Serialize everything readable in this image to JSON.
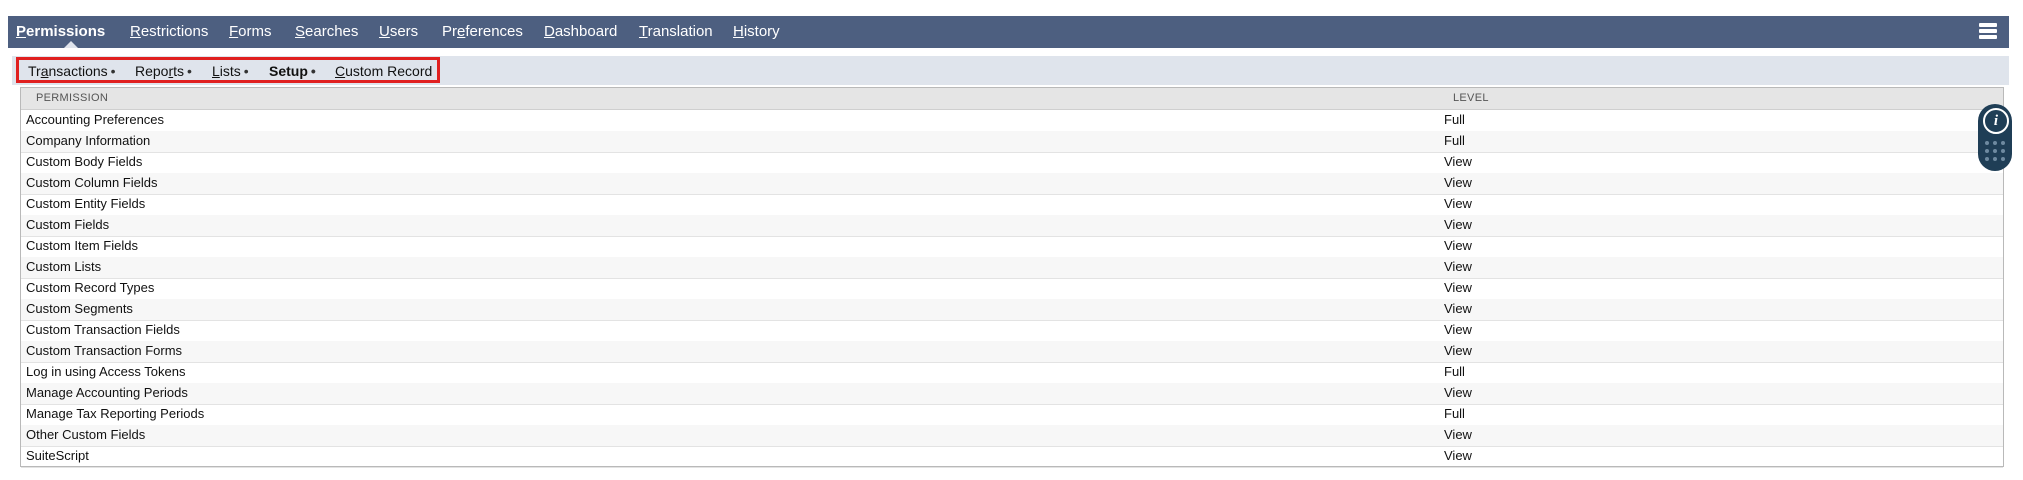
{
  "topnav": {
    "tabs": [
      {
        "label_u": "P",
        "label_rest": "ermissions",
        "active": true
      },
      {
        "label_u": "R",
        "label_rest": "estrictions"
      },
      {
        "label_u": "F",
        "label_rest": "orms"
      },
      {
        "label_u": "S",
        "label_rest": "earches"
      },
      {
        "label_u": "U",
        "label_rest": "sers"
      },
      {
        "label_pre": "Pr",
        "label_u": "e",
        "label_rest": "ferences"
      },
      {
        "label_u": "D",
        "label_rest": "ashboard"
      },
      {
        "label_u": "T",
        "label_rest": "ranslation"
      },
      {
        "label_u": "H",
        "label_rest": "istory"
      }
    ]
  },
  "subtabs": [
    {
      "pre": "Tr",
      "u": "a",
      "rest": "nsactions",
      "bullet": "•"
    },
    {
      "pre": "Repo",
      "u": "r",
      "rest": "ts",
      "bullet": "•"
    },
    {
      "pre": "",
      "u": "L",
      "rest": "ists",
      "bullet": "•"
    },
    {
      "pre": "Setup",
      "u": "",
      "rest": "",
      "bullet": "•",
      "active": true
    },
    {
      "pre": "",
      "u": "C",
      "rest": "ustom Record",
      "bullet": ""
    }
  ],
  "table": {
    "headers": {
      "permission": "PERMISSION",
      "level": "LEVEL"
    },
    "rows": [
      {
        "permission": "Accounting Preferences",
        "level": "Full"
      },
      {
        "permission": "Company Information",
        "level": "Full"
      },
      {
        "permission": "Custom Body Fields",
        "level": "View"
      },
      {
        "permission": "Custom Column Fields",
        "level": "View"
      },
      {
        "permission": "Custom Entity Fields",
        "level": "View"
      },
      {
        "permission": "Custom Fields",
        "level": "View"
      },
      {
        "permission": "Custom Item Fields",
        "level": "View"
      },
      {
        "permission": "Custom Lists",
        "level": "View"
      },
      {
        "permission": "Custom Record Types",
        "level": "View"
      },
      {
        "permission": "Custom Segments",
        "level": "View"
      },
      {
        "permission": "Custom Transaction Fields",
        "level": "View"
      },
      {
        "permission": "Custom Transaction Forms",
        "level": "View"
      },
      {
        "permission": "Log in using Access Tokens",
        "level": "Full"
      },
      {
        "permission": "Manage Accounting Periods",
        "level": "View"
      },
      {
        "permission": "Manage Tax Reporting Periods",
        "level": "Full"
      },
      {
        "permission": "Other Custom Fields",
        "level": "View"
      },
      {
        "permission": "SuiteScript",
        "level": "View"
      }
    ]
  },
  "info_widget": {
    "glyph": "i",
    "icon": "info-icon"
  },
  "colors": {
    "nav_bg": "#4d5f80",
    "subtab_bg": "#dfe4ec",
    "highlight": "#e02020",
    "widget_bg": "#1f3e56"
  }
}
